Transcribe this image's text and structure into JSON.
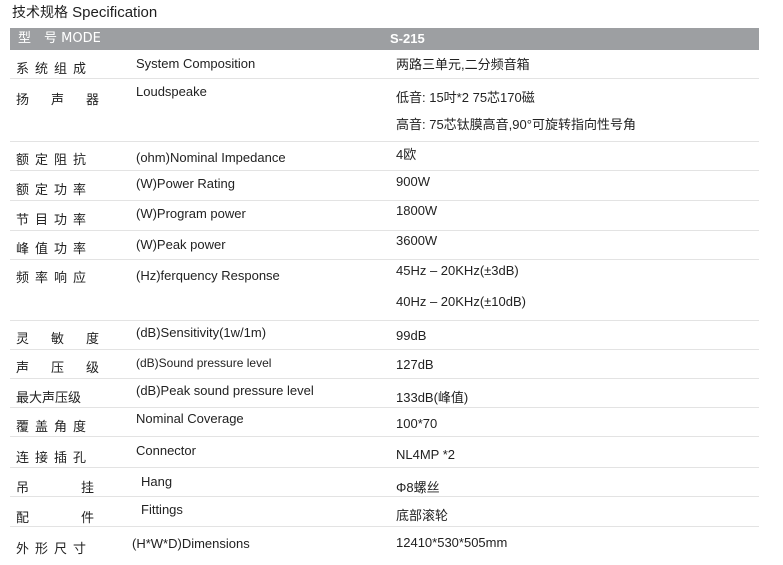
{
  "title": {
    "cn": "技术规格",
    "en": "Specification"
  },
  "header": {
    "type_label": "型　号 MODE",
    "model": "S-215"
  },
  "rows": [
    {
      "cn": "系统组成",
      "en": "System Composition",
      "values": [
        "两路三单元,二分频音箱"
      ]
    },
    {
      "cn": "扬声器",
      "en": "Loudspeake",
      "values": [
        "低音: 15吋*2 75芯170磁",
        "高音: 75芯钛膜高音,90°可旋转指向性号角"
      ]
    },
    {
      "cn": "额定阻抗",
      "en": "(ohm)Nominal  Impedance",
      "values": [
        "4欧"
      ]
    },
    {
      "cn": "额定功率",
      "en": "(W)Power Rating",
      "values": [
        "900W"
      ]
    },
    {
      "cn": "节目功率",
      "en": "(W)Program power",
      "values": [
        "1800W"
      ]
    },
    {
      "cn": "峰值功率",
      "en": "(W)Peak power",
      "values": [
        "3600W"
      ]
    },
    {
      "cn": "频率响应",
      "en": "(Hz)ferquency  Response",
      "values": [
        "45Hz – 20KHz(±3dB)",
        "40Hz – 20KHz(±10dB)"
      ]
    },
    {
      "cn": "灵敏度",
      "en": "(dB)Sensitivity(1w/1m)",
      "values": [
        "99dB"
      ]
    },
    {
      "cn": "声压级",
      "en": "(dB)Sound pressure level",
      "values": [
        "127dB"
      ]
    },
    {
      "cn": "最大声压级",
      "en": "(dB)Peak sound pressure level",
      "values": [
        "133dB(峰值)"
      ]
    },
    {
      "cn": "覆盖角度",
      "en": "Nominal  Coverage",
      "values": [
        "100*70"
      ]
    },
    {
      "cn": "连接插孔",
      "en": "Connector",
      "values": [
        "NL4MP *2"
      ]
    },
    {
      "cn": "吊挂",
      "en": "Hang",
      "values": [
        "Φ8螺丝"
      ]
    },
    {
      "cn": "配件",
      "en": "Fittings",
      "values": [
        "底部滚轮"
      ]
    },
    {
      "cn": "外形尺寸",
      "en": "(H*W*D)Dimensions",
      "values": [
        "12410*530*505mm"
      ]
    }
  ]
}
